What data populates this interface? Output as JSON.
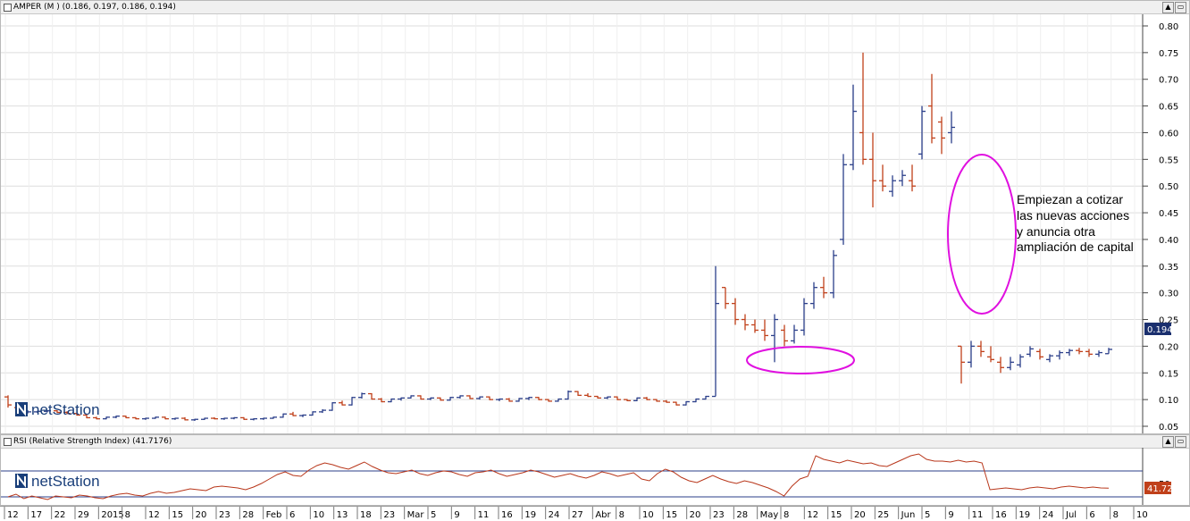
{
  "main_panel": {
    "title": "AMPER (M ) (0.186, 0.197, 0.186, 0.194)",
    "annotation_lines": [
      "Empiezan a cotizar",
      "las nuevas acciones",
      "y anuncia otra",
      "ampliación de capital"
    ],
    "last_price_label": "0.194",
    "logo_text": "netStation"
  },
  "rsi_panel": {
    "title": "RSI (Relative Strength Index) (41.7176)",
    "last_value_label": "41.72",
    "level_label": "50",
    "logo_text": "netStation"
  },
  "window_buttons": {
    "minimize": "▲",
    "maximize": "▭"
  },
  "colors": {
    "up_bar": "#2b3f8a",
    "down_bar": "#c0401a",
    "highlight_ellipse": "#e010e0",
    "rsi_line": "#b8361a",
    "price_tag_bg": "#1a2f6e",
    "rsi_tag_bg": "#c0401a"
  },
  "chart_data": [
    {
      "type": "ohlc",
      "title": "AMPER (M )",
      "ylim": [
        0.0,
        0.82
      ],
      "y_ticks": [
        "0.80",
        "0.75",
        "0.70",
        "0.65",
        "0.60",
        "0.55",
        "0.50",
        "0.45",
        "0.40",
        "0.35",
        "0.30",
        "0.25",
        "0.20",
        "0.15",
        "0.10",
        "0.05"
      ],
      "x_tick_labels": [
        "12",
        "17",
        "22",
        "29",
        "2015",
        "8",
        "12",
        "15",
        "20",
        "23",
        "28",
        "Feb",
        "6",
        "10",
        "13",
        "18",
        "23",
        "Mar",
        "5",
        "9",
        "11",
        "16",
        "19",
        "24",
        "27",
        "Abr",
        "8",
        "10",
        "15",
        "20",
        "23",
        "28",
        "May",
        "8",
        "12",
        "15",
        "20",
        "25",
        "Jun",
        "5",
        "9",
        "11",
        "16",
        "19",
        "24",
        "Jul",
        "6",
        "8",
        "10"
      ],
      "series": [
        {
          "values": [
            [
              0.105,
              0.108,
              0.085,
              0.09
            ],
            [
              0.085,
              0.088,
              0.075,
              0.076
            ],
            [
              0.076,
              0.08,
              0.074,
              0.077
            ],
            [
              0.077,
              0.079,
              0.075,
              0.078
            ],
            [
              0.078,
              0.08,
              0.076,
              0.079
            ],
            [
              0.079,
              0.08,
              0.075,
              0.076
            ],
            [
              0.076,
              0.078,
              0.073,
              0.074
            ],
            [
              0.074,
              0.075,
              0.07,
              0.071
            ],
            [
              0.071,
              0.072,
              0.065,
              0.066
            ],
            [
              0.066,
              0.068,
              0.063,
              0.064
            ],
            [
              0.064,
              0.068,
              0.063,
              0.067
            ],
            [
              0.067,
              0.07,
              0.065,
              0.069
            ],
            [
              0.069,
              0.07,
              0.065,
              0.066
            ],
            [
              0.066,
              0.067,
              0.063,
              0.064
            ],
            [
              0.064,
              0.066,
              0.062,
              0.065
            ],
            [
              0.065,
              0.068,
              0.064,
              0.067
            ],
            [
              0.067,
              0.068,
              0.063,
              0.064
            ],
            [
              0.064,
              0.066,
              0.062,
              0.065
            ],
            [
              0.065,
              0.067,
              0.061,
              0.062
            ],
            [
              0.062,
              0.064,
              0.06,
              0.063
            ],
            [
              0.063,
              0.066,
              0.062,
              0.065
            ],
            [
              0.065,
              0.067,
              0.063,
              0.064
            ],
            [
              0.064,
              0.066,
              0.062,
              0.065
            ],
            [
              0.065,
              0.067,
              0.063,
              0.066
            ],
            [
              0.066,
              0.067,
              0.062,
              0.063
            ],
            [
              0.063,
              0.065,
              0.061,
              0.064
            ],
            [
              0.064,
              0.066,
              0.062,
              0.065
            ],
            [
              0.065,
              0.068,
              0.064,
              0.067
            ],
            [
              0.067,
              0.074,
              0.066,
              0.073
            ],
            [
              0.073,
              0.077,
              0.069,
              0.07
            ],
            [
              0.07,
              0.072,
              0.067,
              0.071
            ],
            [
              0.071,
              0.078,
              0.07,
              0.077
            ],
            [
              0.077,
              0.082,
              0.075,
              0.08
            ],
            [
              0.08,
              0.095,
              0.079,
              0.094
            ],
            [
              0.094,
              0.098,
              0.089,
              0.09
            ],
            [
              0.09,
              0.105,
              0.089,
              0.104
            ],
            [
              0.104,
              0.113,
              0.102,
              0.111
            ],
            [
              0.111,
              0.112,
              0.1,
              0.101
            ],
            [
              0.101,
              0.103,
              0.095,
              0.096
            ],
            [
              0.096,
              0.102,
              0.095,
              0.101
            ],
            [
              0.101,
              0.104,
              0.098,
              0.103
            ],
            [
              0.103,
              0.108,
              0.102,
              0.107
            ],
            [
              0.107,
              0.108,
              0.1,
              0.101
            ],
            [
              0.101,
              0.104,
              0.099,
              0.103
            ],
            [
              0.103,
              0.104,
              0.098,
              0.099
            ],
            [
              0.099,
              0.105,
              0.098,
              0.104
            ],
            [
              0.104,
              0.108,
              0.102,
              0.107
            ],
            [
              0.107,
              0.108,
              0.101,
              0.102
            ],
            [
              0.102,
              0.106,
              0.1,
              0.105
            ],
            [
              0.105,
              0.106,
              0.099,
              0.1
            ],
            [
              0.1,
              0.102,
              0.097,
              0.101
            ],
            [
              0.101,
              0.103,
              0.096,
              0.097
            ],
            [
              0.097,
              0.103,
              0.096,
              0.102
            ],
            [
              0.102,
              0.105,
              0.099,
              0.104
            ],
            [
              0.104,
              0.105,
              0.099,
              0.1
            ],
            [
              0.1,
              0.101,
              0.096,
              0.097
            ],
            [
              0.097,
              0.102,
              0.096,
              0.101
            ],
            [
              0.101,
              0.117,
              0.1,
              0.115
            ],
            [
              0.115,
              0.116,
              0.107,
              0.108
            ],
            [
              0.108,
              0.112,
              0.105,
              0.106
            ],
            [
              0.106,
              0.107,
              0.102,
              0.103
            ],
            [
              0.103,
              0.106,
              0.101,
              0.105
            ],
            [
              0.105,
              0.106,
              0.099,
              0.1
            ],
            [
              0.1,
              0.101,
              0.097,
              0.098
            ],
            [
              0.098,
              0.104,
              0.097,
              0.103
            ],
            [
              0.103,
              0.105,
              0.099,
              0.1
            ],
            [
              0.1,
              0.101,
              0.096,
              0.097
            ],
            [
              0.097,
              0.099,
              0.094,
              0.095
            ],
            [
              0.095,
              0.096,
              0.089,
              0.09
            ],
            [
              0.09,
              0.097,
              0.089,
              0.096
            ],
            [
              0.096,
              0.102,
              0.095,
              0.101
            ],
            [
              0.101,
              0.107,
              0.1,
              0.106
            ],
            [
              0.106,
              0.35,
              0.106,
              0.28
            ],
            [
              0.31,
              0.31,
              0.27,
              0.28
            ],
            [
              0.28,
              0.29,
              0.24,
              0.25
            ],
            [
              0.25,
              0.26,
              0.23,
              0.24
            ],
            [
              0.24,
              0.25,
              0.225,
              0.23
            ],
            [
              0.23,
              0.25,
              0.21,
              0.22
            ],
            [
              0.22,
              0.26,
              0.17,
              0.25
            ],
            [
              0.23,
              0.24,
              0.2,
              0.21
            ],
            [
              0.21,
              0.24,
              0.205,
              0.23
            ],
            [
              0.23,
              0.29,
              0.22,
              0.28
            ],
            [
              0.28,
              0.32,
              0.27,
              0.31
            ],
            [
              0.31,
              0.33,
              0.29,
              0.3
            ],
            [
              0.3,
              0.38,
              0.29,
              0.37
            ],
            [
              0.4,
              0.56,
              0.39,
              0.54
            ],
            [
              0.54,
              0.69,
              0.53,
              0.64
            ],
            [
              0.6,
              0.75,
              0.54,
              0.55
            ],
            [
              0.55,
              0.6,
              0.46,
              0.51
            ],
            [
              0.51,
              0.54,
              0.49,
              0.5
            ],
            [
              0.49,
              0.52,
              0.48,
              0.51
            ],
            [
              0.51,
              0.53,
              0.5,
              0.52
            ],
            [
              0.51,
              0.54,
              0.49,
              0.5
            ],
            [
              0.56,
              0.65,
              0.55,
              0.64
            ],
            [
              0.65,
              0.71,
              0.58,
              0.59
            ],
            [
              0.62,
              0.63,
              0.56,
              0.59
            ],
            [
              0.6,
              0.64,
              0.58,
              0.61
            ],
            [
              0.2,
              0.2,
              0.13,
              0.17
            ],
            [
              0.17,
              0.21,
              0.16,
              0.2
            ],
            [
              0.2,
              0.21,
              0.18,
              0.19
            ],
            [
              0.18,
              0.2,
              0.17,
              0.175
            ],
            [
              0.17,
              0.18,
              0.15,
              0.16
            ],
            [
              0.16,
              0.18,
              0.155,
              0.17
            ],
            [
              0.165,
              0.185,
              0.16,
              0.18
            ],
            [
              0.185,
              0.2,
              0.18,
              0.195
            ],
            [
              0.19,
              0.195,
              0.175,
              0.18
            ],
            [
              0.175,
              0.185,
              0.17,
              0.182
            ],
            [
              0.182,
              0.192,
              0.175,
              0.188
            ],
            [
              0.188,
              0.195,
              0.182,
              0.192
            ],
            [
              0.192,
              0.197,
              0.185,
              0.19
            ],
            [
              0.19,
              0.195,
              0.18,
              0.185
            ],
            [
              0.185,
              0.192,
              0.18,
              0.188
            ],
            [
              0.186,
              0.197,
              0.186,
              0.194
            ]
          ]
        }
      ]
    },
    {
      "type": "line",
      "title": "RSI (Relative Strength Index)",
      "ylim": [
        0,
        100
      ],
      "y_ticks": [
        "50"
      ],
      "reference_levels": [
        70,
        30
      ],
      "series": [
        {
          "values": [
            32,
            35,
            30,
            33,
            31,
            29,
            33,
            32,
            31,
            34,
            33,
            31,
            30,
            33,
            35,
            36,
            34,
            33,
            36,
            38,
            36,
            37,
            39,
            41,
            40,
            39,
            43,
            44,
            43,
            42,
            40,
            43,
            47,
            52,
            57,
            60,
            56,
            55,
            62,
            67,
            70,
            68,
            65,
            63,
            67,
            71,
            66,
            62,
            59,
            58,
            60,
            62,
            58,
            56,
            59,
            61,
            60,
            57,
            55,
            59,
            60,
            62,
            58,
            55,
            57,
            59,
            62,
            60,
            57,
            54,
            56,
            58,
            55,
            53,
            56,
            60,
            58,
            55,
            57,
            59,
            52,
            50,
            58,
            63,
            60,
            54,
            50,
            48,
            52,
            56,
            52,
            49,
            47,
            50,
            48,
            45,
            42,
            38,
            33,
            44,
            52,
            55,
            78,
            74,
            72,
            70,
            73,
            71,
            69,
            70,
            67,
            66,
            70,
            74,
            78,
            80,
            74,
            72,
            72,
            71,
            73,
            71,
            72,
            70,
            40,
            41,
            42,
            41,
            40,
            42,
            43,
            42,
            41,
            43,
            44,
            43,
            42,
            43,
            42,
            41.72
          ]
        }
      ]
    }
  ]
}
